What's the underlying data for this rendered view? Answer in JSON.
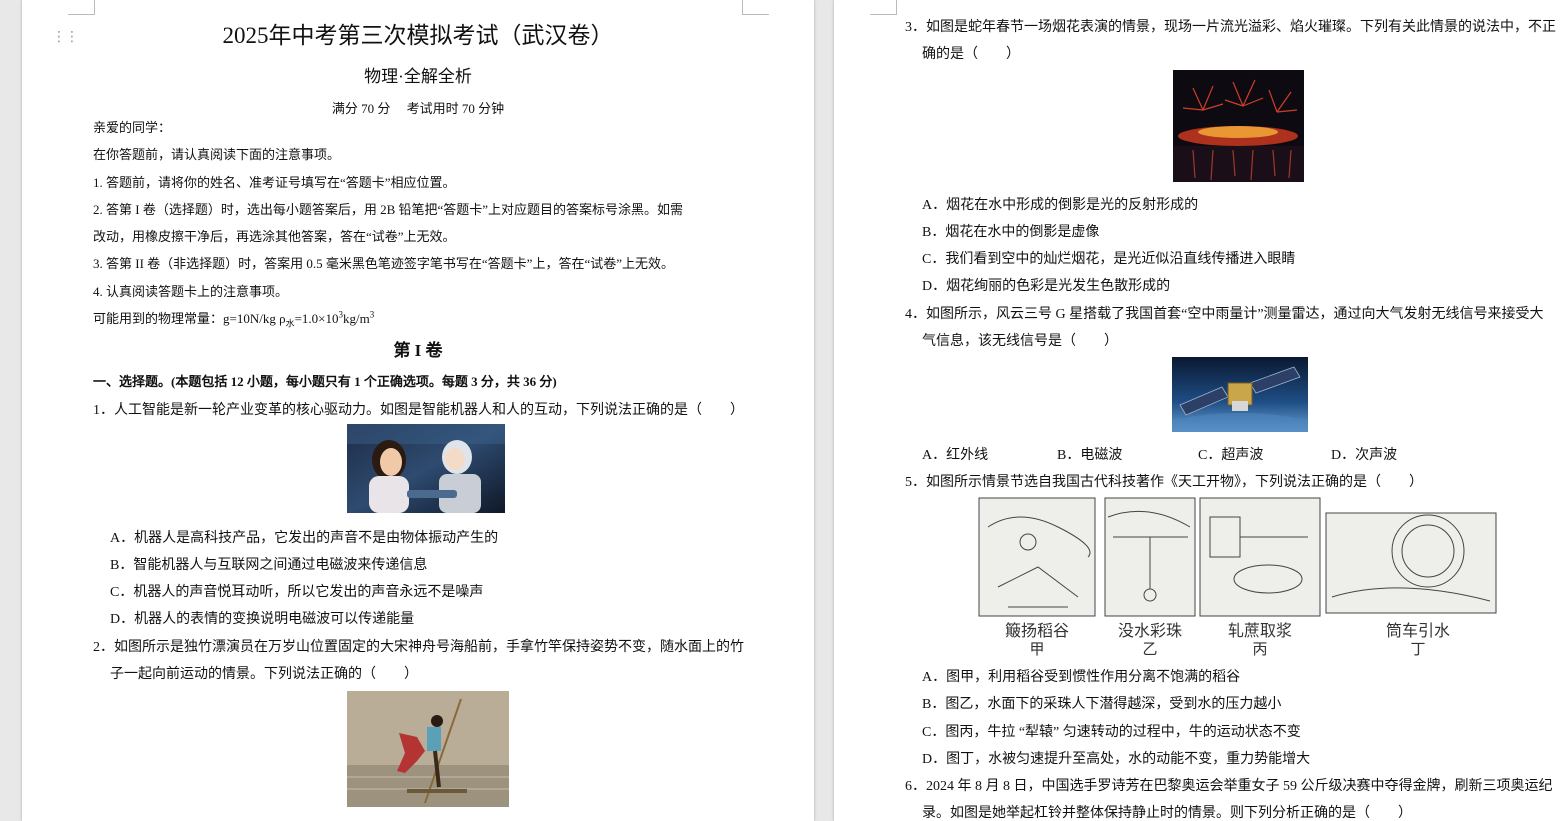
{
  "left_page": {
    "title": "2025年中考第三次模拟考试（武汉卷）",
    "subtitle": "物理·全解全析",
    "score_info": "满分 70 分　 考试用时 70 分钟",
    "greeting": "亲爱的同学：",
    "intro": "在你答题前，请认真阅读下面的注意事项。",
    "notice1": "1. 答题前，请将你的姓名、准考证号填写在“答题卡”相应位置。",
    "notice2a": "2. 答第 I 卷（选择题）时，选出每小题答案后，用 2B 铅笔把“答题卡”上对应题目的答案标号涂黑。如需",
    "notice2b": "改动，用橡皮擦干净后，再选涂其他答案，答在“试卷”上无效。",
    "notice3": "3. 答第 II 卷（非选择题）时，答案用 0.5 毫米黑色笔迹签字笔书写在“答题卡”上，答在“试卷”上无效。",
    "notice4": "4. 认真阅读答题卡上的注意事项。",
    "constants_prefix": "可能用到的物理常量：g=10N/kg ρ",
    "constants_sub": "水",
    "constants_mid": "=1.0×10",
    "constants_sup": "3",
    "constants_unit": "kg/m",
    "constants_sup2": "3",
    "section_title": "第 I 卷",
    "section_heading": "一、选择题。(本题包括 12 小题，每小题只有 1 个正确选项。每题 3 分，共 36 分)",
    "q1": {
      "stem": "1．人工智能是新一轮产业变革的核心驱动力。如图是智能机器人和人的互动，下列说法正确的是（　　）",
      "A": "A．机器人是高科技产品，它发出的声音不是由物体振动产生的",
      "B": "B．智能机器人与互联网之间通过电磁波来传递信息",
      "C": "C．机器人的声音悦耳动听，所以它发出的声音永远不是噪声",
      "D": "D．机器人的表情的变换说明电磁波可以传递能量"
    },
    "q2": {
      "stem_a": "2．如图所示是独竹漂演员在万岁山位置固定的大宋神舟号海船前，手拿竹竿保持姿势不变，随水面上的竹",
      "stem_b": "子一起向前运动的情景。下列说法正确的（　　）"
    }
  },
  "right_page": {
    "q3": {
      "stem_a": "3．如图是蛇年春节一场烟花表演的情景，现场一片流光溢彩、焰火璀璨。下列有关此情景的说法中，不正",
      "stem_b": "确的是（　　）",
      "A": "A．烟花在水中形成的倒影是光的反射形成的",
      "B": "B．烟花在水中的倒影是虚像",
      "C": "C．我们看到空中的灿烂烟花，是光近似沿直线传播进入眼睛",
      "D": "D．烟花绚丽的色彩是光发生色散形成的"
    },
    "q4": {
      "stem_a": "4．如图所示，风云三号 G 星搭载了我国首套“空中雨量计”测量雷达，通过向大气发射无线信号来接受大",
      "stem_b": "气信息，该无线信号是（　　）",
      "A": "A．红外线",
      "B": "B．电磁波",
      "C": "C．超声波",
      "D": "D．次声波"
    },
    "q5": {
      "stem": "5．如图所示情景节选自我国古代科技著作《天工开物》，下列说法正确的是（　　）",
      "captions": [
        {
          "name": "簸扬稻谷",
          "tag": "甲"
        },
        {
          "name": "没水彩珠",
          "tag": "乙"
        },
        {
          "name": "轧蔗取浆",
          "tag": "丙"
        },
        {
          "name": "筒车引水",
          "tag": "丁"
        }
      ],
      "A": "A．图甲，利用稻谷受到惯性作用分离不饱满的稻谷",
      "B": "B．图乙，水面下的采珠人下潜得越深，受到水的压力越小",
      "C": "C．图丙，牛拉 “犁辕” 匀速转动的过程中，牛的运动状态不变",
      "D": "D．图丁，水被匀速提升至高处，水的动能不变，重力势能增大"
    },
    "q6": {
      "stem_a": "6．2024 年 8 月 8 日，中国选手罗诗芳在巴黎奥运会举重女子 59 公斤级决赛中夺得金牌，刷新三项奥运纪",
      "stem_b": "录。如图是她举起杠铃并整体保持静止时的情景。则下列分析正确的是（　　）"
    }
  }
}
